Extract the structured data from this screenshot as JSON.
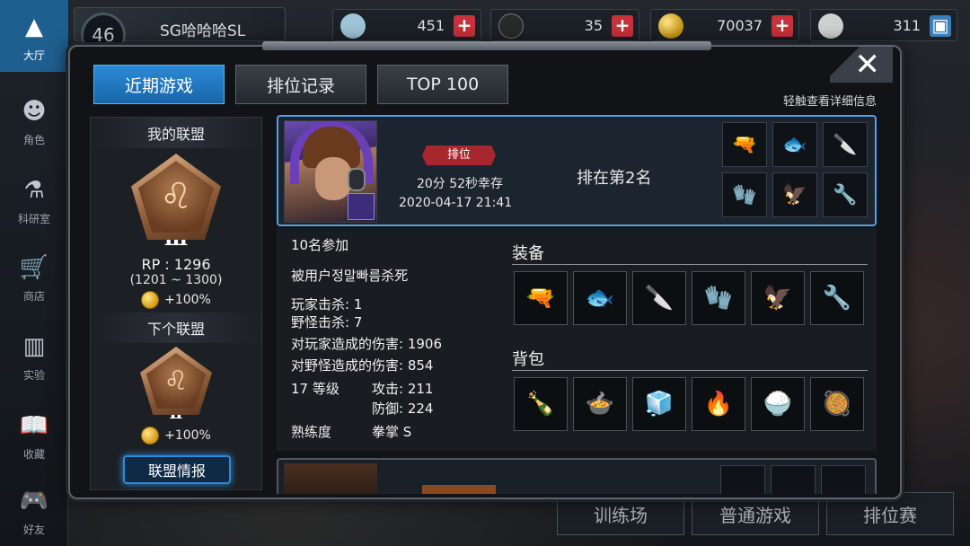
{
  "colors": {
    "accent_blue": "#2d8ad6",
    "badge_red": "#a8262e",
    "plus_red": "#c8323a",
    "panel": "#1c2025"
  },
  "nav": {
    "items": [
      {
        "label": "大厅",
        "icon": "lobby-icon",
        "active": true
      },
      {
        "label": "角色",
        "icon": "character-icon"
      },
      {
        "label": "科研室",
        "icon": "flask-icon"
      },
      {
        "label": "商店",
        "icon": "cart-icon"
      },
      {
        "label": "实验",
        "icon": "books-icon"
      },
      {
        "label": "收藏",
        "icon": "open-book-icon"
      },
      {
        "label": "好友",
        "icon": "gamepad-icon"
      }
    ]
  },
  "player": {
    "level": "46",
    "name": "SG哈哈哈SL"
  },
  "resources": [
    {
      "icon": "crystal-icon",
      "value": "451"
    },
    {
      "icon": "ticket-icon",
      "value": "35"
    },
    {
      "icon": "coin-icon",
      "value": "70037"
    },
    {
      "icon": "bp-icon",
      "value": "311"
    }
  ],
  "background_tabs": [
    "训练场",
    "普通游戏",
    "排位赛"
  ],
  "modal": {
    "tabs": [
      "近期游戏",
      "排位记录",
      "TOP 100"
    ],
    "hint": "轻触查看详细信息",
    "close": "✕"
  },
  "alliance": {
    "my_title": "我的联盟",
    "my_tier": "Ⅲ",
    "rp": "RP : 1296",
    "rp_range": "(1201 ~ 1300)",
    "my_bonus": "+100%",
    "next_title": "下个联盟",
    "next_tier": "Ⅱ",
    "next_bonus": "+100%",
    "button": "联盟情报"
  },
  "match": {
    "mode_badge": "排位",
    "survival": "20分 52秒幸存",
    "datetime": "2020-04-17 21:41",
    "placing": "排在第2名",
    "mini_items": [
      "🔫",
      "🐟",
      "🔪",
      "🧤",
      "🦅",
      "🔧"
    ]
  },
  "detail": {
    "participants": "10名参加",
    "killed_by": "被用户정말빠름杀死",
    "player_kills": "玩家击杀: 1",
    "monster_kills": "野怪击杀: 7",
    "dmg_players": "对玩家造成的伤害: 1906",
    "dmg_monsters": "对野怪造成的伤害: 854",
    "level": "17 等级",
    "attack": "攻击: 211",
    "defense": "防御: 224",
    "proficiency_label": "熟练度",
    "proficiency_value": "拳掌 S",
    "equipment_title": "装备",
    "equipment": [
      "🔫",
      "🐟",
      "🔪",
      "🧤",
      "🦅",
      "🔧"
    ],
    "bag_title": "背包",
    "bag": [
      "🍾",
      "🍲",
      "🧊",
      "🔥",
      "🍚",
      "🥘"
    ]
  }
}
